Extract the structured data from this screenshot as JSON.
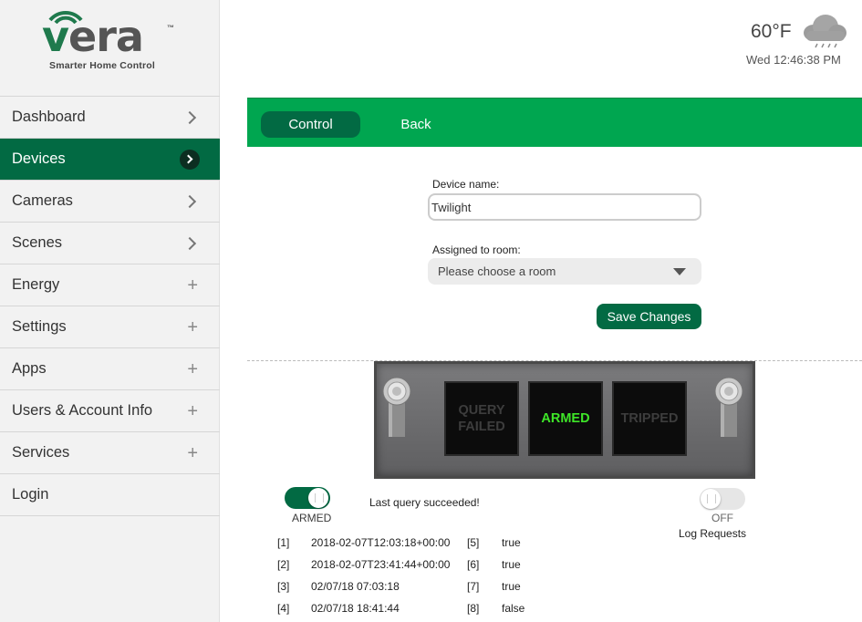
{
  "logo": {
    "word": "vera",
    "tm": "™",
    "tagline": "Smarter Home Control"
  },
  "weather": {
    "temperature": "60°F",
    "datetime": "Wed 12:46:38 PM",
    "icon": "rain-cloud-icon"
  },
  "sidebar": {
    "items": [
      {
        "label": "Dashboard",
        "indicator": "chevron"
      },
      {
        "label": "Devices",
        "indicator": "chevron",
        "active": true
      },
      {
        "label": "Cameras",
        "indicator": "chevron"
      },
      {
        "label": "Scenes",
        "indicator": "chevron"
      },
      {
        "label": "Energy",
        "indicator": "plus"
      },
      {
        "label": "Settings",
        "indicator": "plus"
      },
      {
        "label": "Apps",
        "indicator": "plus"
      },
      {
        "label": "Users & Account Info",
        "indicator": "plus"
      },
      {
        "label": "Services",
        "indicator": "plus"
      },
      {
        "label": "Login",
        "indicator": "none"
      }
    ]
  },
  "tabs": {
    "control": "Control",
    "back": "Back"
  },
  "form": {
    "device_name_label": "Device name:",
    "device_name_value": "Twilight",
    "room_label": "Assigned to room:",
    "room_value": "Please choose a room",
    "save_label": "Save Changes"
  },
  "panel": {
    "lamps": [
      {
        "label": "QUERY FAILED",
        "lit": false
      },
      {
        "label": "ARMED",
        "lit": true
      },
      {
        "label": "TRIPPED",
        "lit": false
      }
    ]
  },
  "controls": {
    "armed_label": "ARMED",
    "status_text": "Last query succeeded!",
    "log_state": "OFF",
    "log_label": "Log Requests"
  },
  "variables": [
    {
      "idx": "[1]",
      "value": "2018-02-07T12:03:18+00:00",
      "idx2": "[5]",
      "value2": "true"
    },
    {
      "idx": "[2]",
      "value": "2018-02-07T23:41:44+00:00",
      "idx2": "[6]",
      "value2": "true"
    },
    {
      "idx": "[3]",
      "value": "02/07/18 07:03:18",
      "idx2": "[7]",
      "value2": "true"
    },
    {
      "idx": "[4]",
      "value": "02/07/18 18:41:44",
      "idx2": "[8]",
      "value2": "false"
    }
  ],
  "colors": {
    "brand_green": "#00a650",
    "dark_green": "#026a43",
    "lamp_on": "#3ee628"
  }
}
